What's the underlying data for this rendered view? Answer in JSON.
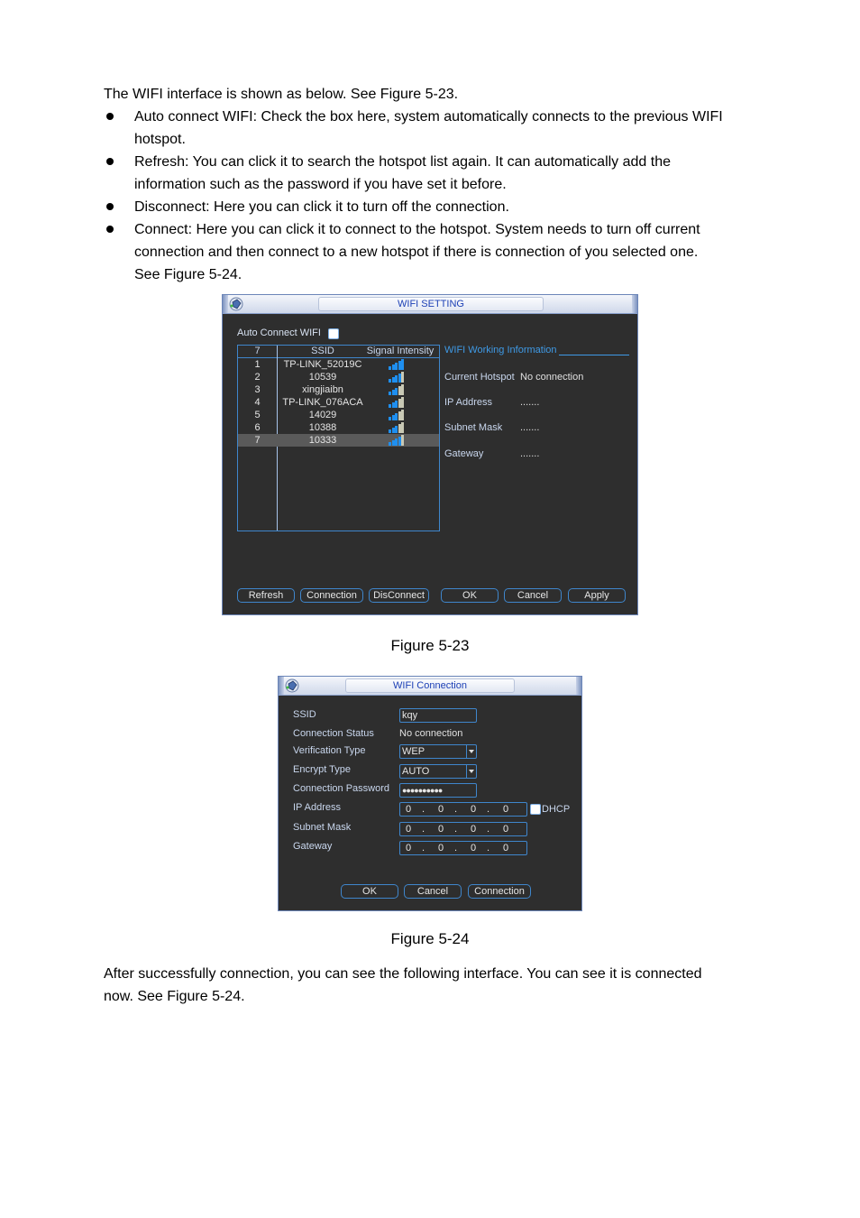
{
  "doc": {
    "intro": "The WIFI interface is shown as below. See Figure 5-23.",
    "bullets": [
      [
        "Auto connect WIFI: Check the box here, system automatically connects to the previous WIFI",
        "hotspot."
      ],
      [
        "Refresh: You can click it to search the hotspot list again. It can automatically add the",
        "information such as the password if you have set it before."
      ],
      [
        "Disconnect: Here you can click it to turn off the connection."
      ],
      [
        "Connect: Here you can click it to connect to the hotspot. System needs to turn off current",
        "connection and then connect to a new hotspot if there is connection of you selected one.",
        "See Figure 5-24."
      ]
    ],
    "caption1": "Figure 5-23",
    "caption2": "Figure 5-24",
    "outro": [
      "After successfully connection, you can see the following interface. You can see it is connected",
      "now. See Figure 5-24."
    ]
  },
  "wifi_setting": {
    "title": "WIFI SETTING",
    "auto_connect_label": "Auto Connect WIFI",
    "auto_connect_checked": false,
    "list": {
      "headers": [
        "7",
        "SSID",
        "Signal Intensity"
      ],
      "rows": [
        {
          "no": "1",
          "ssid": "TP-LINK_52019C",
          "signal": 5
        },
        {
          "no": "2",
          "ssid": "10539",
          "signal": 4
        },
        {
          "no": "3",
          "ssid": "xingjiaibn",
          "signal": 3
        },
        {
          "no": "4",
          "ssid": "TP-LINK_076ACA",
          "signal": 3
        },
        {
          "no": "5",
          "ssid": "14029",
          "signal": 3
        },
        {
          "no": "6",
          "ssid": "10388",
          "signal": 3
        },
        {
          "no": "7",
          "ssid": "10333",
          "signal": 4,
          "selected": true
        }
      ],
      "signal_max": 5
    },
    "info": {
      "heading": "WIFI Working Information",
      "current_hotspot_label": "Current Hotspot",
      "current_hotspot_value": "No connection",
      "ip_label": "IP Address",
      "ip_value": ".......",
      "subnet_label": "Subnet Mask",
      "subnet_value": ".......",
      "gateway_label": "Gateway",
      "gateway_value": "......."
    },
    "buttons": {
      "refresh": "Refresh",
      "connection": "Connection",
      "disconnect": "DisConnect",
      "ok": "OK",
      "cancel": "Cancel",
      "apply": "Apply"
    }
  },
  "wifi_connection": {
    "title": "WIFI Connection",
    "ssid_label": "SSID",
    "ssid_value": "kqy",
    "status_label": "Connection Status",
    "status_value": "No connection",
    "verification_label": "Verification Type",
    "verification_value": "WEP",
    "encrypt_label": "Encrypt Type",
    "encrypt_value": "AUTO",
    "password_label": "Connection Password",
    "password_value": "●●●●●●●●●●",
    "ip_label": "IP Address",
    "ip_value": [
      "0",
      "0",
      "0",
      "0"
    ],
    "dhcp_label": "DHCP",
    "dhcp_checked": false,
    "subnet_label": "Subnet Mask",
    "subnet_value": [
      "0",
      "0",
      "0",
      "0"
    ],
    "gateway_label": "Gateway",
    "gateway_value": [
      "0",
      "0",
      "0",
      "0"
    ],
    "buttons": {
      "ok": "OK",
      "cancel": "Cancel",
      "connection": "Connection"
    }
  },
  "colors": {
    "accent": "#3f86cc",
    "signal_on": "#1e8ff0",
    "signal_off": "#c8c8b4",
    "panel_bg": "#2e2e2e"
  }
}
